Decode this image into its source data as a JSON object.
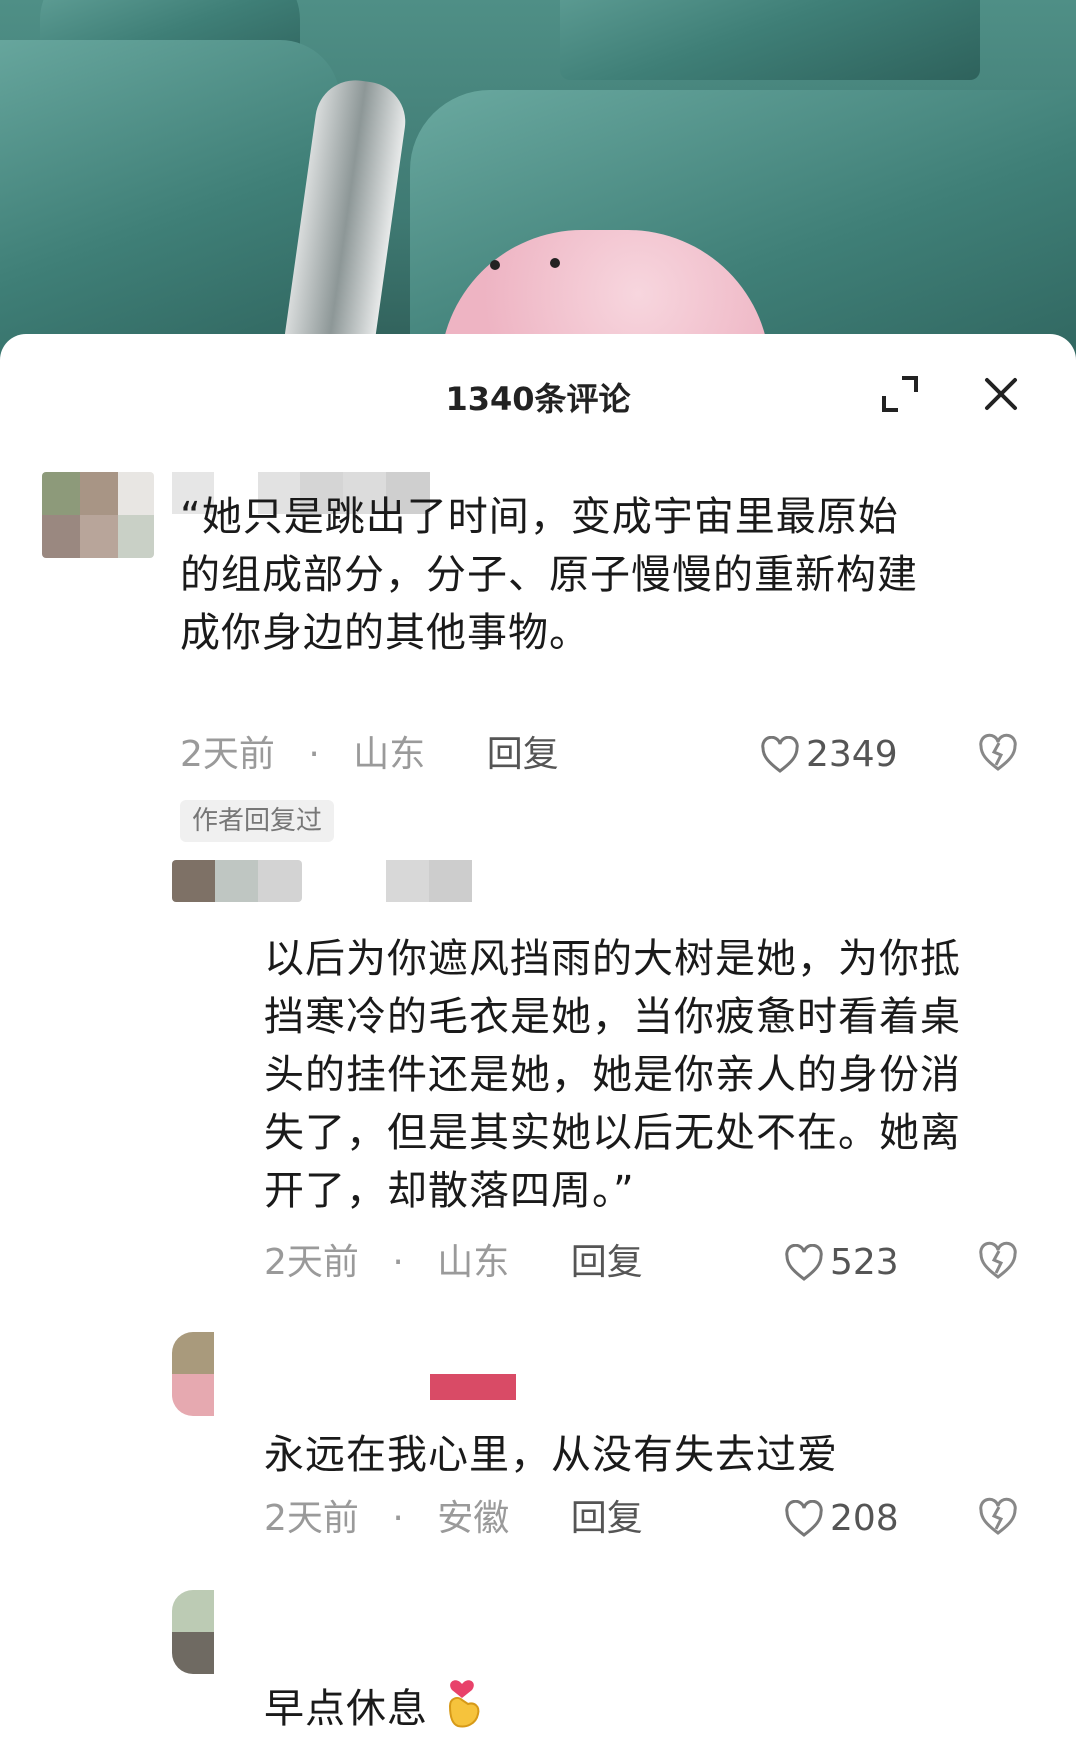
{
  "header": {
    "title": "1340条评论"
  },
  "icons": {
    "expand": "expand-icon",
    "close": "close-icon",
    "like": "heart-icon",
    "dislike": "broken-heart-icon",
    "emoji": "finger-heart-emoji-icon"
  },
  "colors": {
    "text": "#1a1a1a",
    "meta": "#9a9a9a",
    "reply": "#555555",
    "badge_bg": "#f0f0f0"
  },
  "comments": [
    {
      "text_lines": [
        "“她只是跳出了时间，变成宇宙里最原始",
        "的组成部分，分子、原子慢慢的重新构建",
        "成你身边的其他事物。"
      ],
      "time": "2天前",
      "sep": "·",
      "location": "山东",
      "reply": "回复",
      "likes": "2349",
      "badge": "作者回复过"
    },
    {
      "text_lines": [
        "以后为你遮风挡雨的大树是她，为你抵",
        "挡寒冷的毛衣是她，当你疲惫时看着桌",
        "头的挂件还是她，她是你亲人的身份消",
        "失了，但是其实她以后无处不在。她离",
        "开了，却散落四周。”"
      ],
      "time": "2天前",
      "sep": "·",
      "location": "山东",
      "reply": "回复",
      "likes": "523"
    },
    {
      "text_lines": [
        "永远在我心里，从没有失去过爱"
      ],
      "time": "2天前",
      "sep": "·",
      "location": "安徽",
      "reply": "回复",
      "likes": "208"
    },
    {
      "text_lines": [
        "早点休息"
      ]
    }
  ]
}
